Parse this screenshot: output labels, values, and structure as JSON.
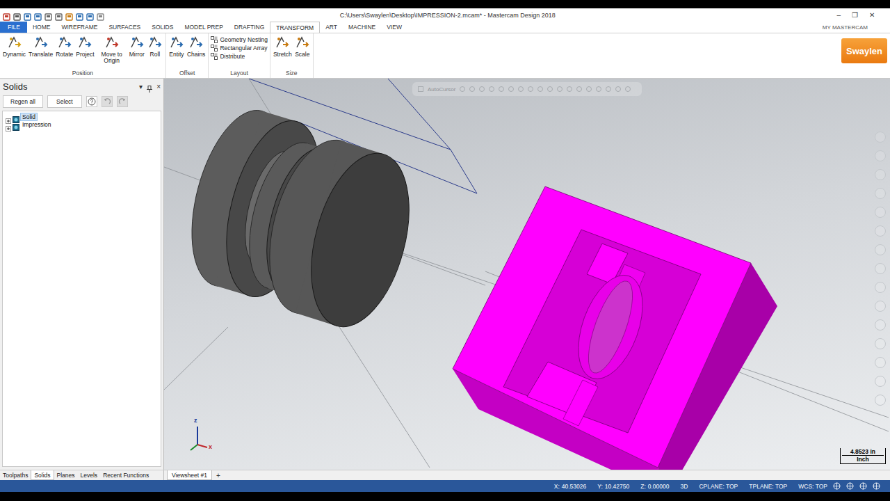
{
  "window": {
    "title": "C:\\Users\\Swaylen\\Desktop\\IMPRESSION-2.mcam* - Mastercam Design 2018",
    "controls": [
      "–",
      "❐",
      "✕"
    ]
  },
  "ribbon": {
    "tabs": [
      {
        "label": "FILE",
        "selected": false,
        "kind": "file"
      },
      {
        "label": "HOME",
        "selected": false,
        "kind": "tab"
      },
      {
        "label": "WIREFRAME",
        "selected": false,
        "kind": "tab"
      },
      {
        "label": "SURFACES",
        "selected": false,
        "kind": "tab"
      },
      {
        "label": "SOLIDS",
        "selected": false,
        "kind": "tab"
      },
      {
        "label": "MODEL PREP",
        "selected": false,
        "kind": "tab"
      },
      {
        "label": "DRAFTING",
        "selected": false,
        "kind": "tab"
      },
      {
        "label": "TRANSFORM",
        "selected": true,
        "kind": "tab"
      },
      {
        "label": "ART",
        "selected": false,
        "kind": "tab"
      },
      {
        "label": "MACHINE",
        "selected": false,
        "kind": "tab"
      },
      {
        "label": "VIEW",
        "selected": false,
        "kind": "tab"
      }
    ],
    "account": "MY MASTERCAM",
    "logo": "Swaylen",
    "groups": [
      {
        "name": "Position",
        "buttons": [
          {
            "label": "Dynamic",
            "kind": "large"
          },
          {
            "label": "Translate",
            "kind": "large"
          },
          {
            "label": "Rotate",
            "kind": "large"
          },
          {
            "label": "Project",
            "kind": "large"
          },
          {
            "label": "Move to Origin",
            "kind": "large"
          },
          {
            "label": "Mirror",
            "kind": "large"
          },
          {
            "label": "Roll",
            "kind": "large"
          }
        ]
      },
      {
        "name": "Offset",
        "buttons": [
          {
            "label": "Entity",
            "kind": "large"
          },
          {
            "label": "Chains",
            "kind": "large"
          }
        ]
      },
      {
        "name": "Layout",
        "buttons": [
          {
            "label": "Geometry Nesting",
            "kind": "small"
          },
          {
            "label": "Rectangular Array",
            "kind": "small"
          },
          {
            "label": "Distribute",
            "kind": "small"
          }
        ]
      },
      {
        "name": "Size",
        "buttons": [
          {
            "label": "Stretch",
            "kind": "large"
          },
          {
            "label": "Scale",
            "kind": "large"
          }
        ]
      }
    ]
  },
  "panel": {
    "title": "Solids",
    "controls": [
      "▾",
      "×"
    ],
    "buttons": [
      "Regen all",
      "Select"
    ],
    "tree": [
      {
        "label": "Solid",
        "selected": true,
        "expanded": false
      },
      {
        "label": "Impression",
        "selected": false,
        "expanded": false
      }
    ],
    "tabs": [
      {
        "label": "Toolpaths",
        "selected": false
      },
      {
        "label": "Solids",
        "selected": true
      },
      {
        "label": "Planes",
        "selected": false
      },
      {
        "label": "Levels",
        "selected": false
      },
      {
        "label": "Recent Functions",
        "selected": false
      }
    ]
  },
  "viewport": {
    "autocursor": "AutoCursor",
    "scale": {
      "value": "4.8523 in",
      "unit": "Inch"
    },
    "axes": [
      "z",
      "x"
    ]
  },
  "viewsheets": {
    "tabs": [
      {
        "label": "Viewsheet #1",
        "selected": true
      }
    ],
    "add": "+"
  },
  "status_bar": {
    "coords": [
      {
        "label": "X:",
        "value": "40.53026"
      },
      {
        "label": "Y:",
        "value": "10.42750"
      },
      {
        "label": "Z:",
        "value": "0.00000"
      }
    ],
    "items": [
      "3D",
      "CPLANE: TOP",
      "TPLANE: TOP",
      "WCS: TOP"
    ]
  }
}
